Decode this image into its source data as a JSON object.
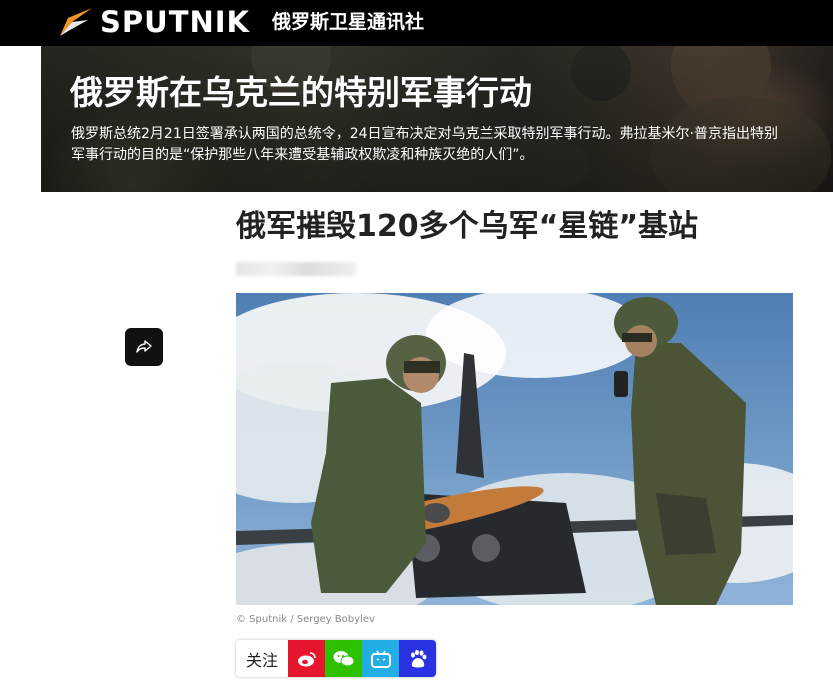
{
  "header": {
    "brand": "SPUTNIK",
    "tagline": "俄罗斯卫星通讯社",
    "logo_icon": "sputnik-logo-icon"
  },
  "banner": {
    "title": "俄罗斯在乌克兰的特别军事行动",
    "description": "俄罗斯总统2月21日签署承认两国的总统令，24日宣布决定对乌克兰采取特别军事行动。弗拉基米尔·普京指出特别军事行动的目的是“保护那些八年来遭受基辅政权欺凌和种族灭绝的人们”。"
  },
  "article": {
    "title": "俄军摧毁120多个乌军“星链”基站",
    "image_caption": "© Sputnik / Sergey Bobylev"
  },
  "share": {
    "icon": "share-arrow-icon"
  },
  "follow": {
    "label": "关注",
    "buttons": [
      {
        "icon": "weibo-icon",
        "color": "#e6162d"
      },
      {
        "icon": "wechat-icon",
        "color": "#2dc100"
      },
      {
        "icon": "bilibili-icon",
        "color": "#23ade5"
      },
      {
        "icon": "baidu-icon",
        "color": "#2932e1"
      }
    ]
  }
}
